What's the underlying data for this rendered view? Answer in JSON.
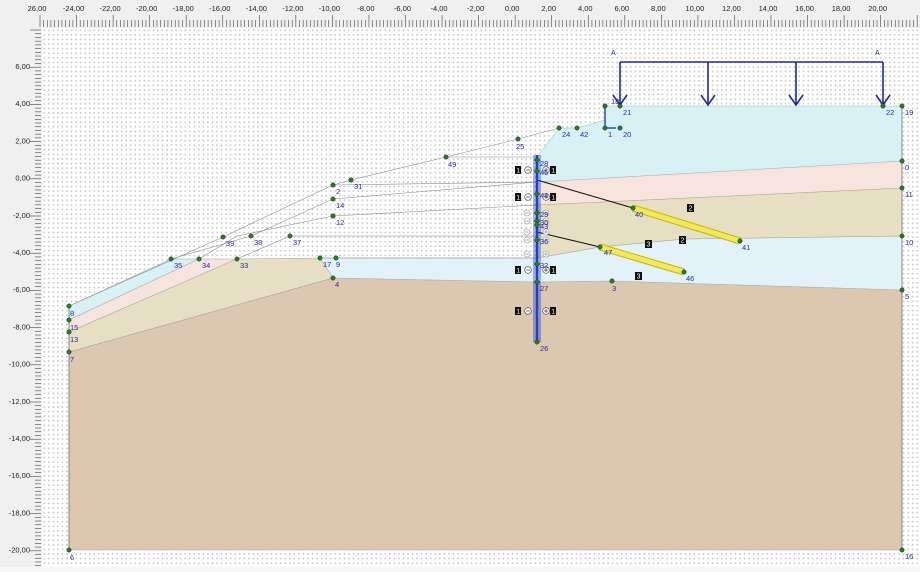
{
  "ruler": {
    "x_labels": [
      "26,00",
      "-24,00",
      "-22,00",
      "-20,00",
      "-18,00",
      "-16,00",
      "-14,00",
      "-12,00",
      "-10,00",
      "-8,00",
      "-6,00",
      "-4,00",
      "-2,00",
      "0,00",
      "2,00",
      "4,00",
      "6,00",
      "8,00",
      "10,00",
      "12,00",
      "14,00",
      "16,00",
      "18,00",
      "20,00"
    ],
    "y_labels": [
      "6,00",
      "4,00",
      "2,00",
      "0,00",
      "-2,00",
      "-4,00",
      "-6,00",
      "-8,00",
      "-10,00",
      "-12,00",
      "-14,00",
      "-16,00",
      "-18,00",
      "-20,00"
    ]
  },
  "load": {
    "labels": [
      "A",
      "A"
    ]
  },
  "points": [
    "18",
    "21",
    "22",
    "19",
    "1",
    "20",
    "24",
    "42",
    "25",
    "49",
    "28",
    "31",
    "2",
    "14",
    "12",
    "39",
    "38",
    "37",
    "35",
    "34",
    "33",
    "17",
    "9",
    "4",
    "8",
    "15",
    "13",
    "7",
    "6",
    "16",
    "0",
    "11",
    "10",
    "5",
    "40",
    "41",
    "47",
    "46",
    "3",
    "27",
    "26",
    "29",
    "30",
    "36",
    "32",
    "45",
    "44",
    "43"
  ],
  "tags": {
    "anchor_upper": "2",
    "anchor_lower": "3",
    "wall_strut": "1"
  },
  "colors": {
    "layer_sky": "#d8f1f4",
    "layer_pink": "#f8e4de",
    "layer_khaki": "#e6dfc3",
    "layer_lightblue": "#e2f2f8",
    "layer_soil": "#dcc8b0",
    "load": "#1e2a96",
    "wall": "#1f3ecc",
    "grout": "#f1e860",
    "node": "#2a7a2a"
  }
}
